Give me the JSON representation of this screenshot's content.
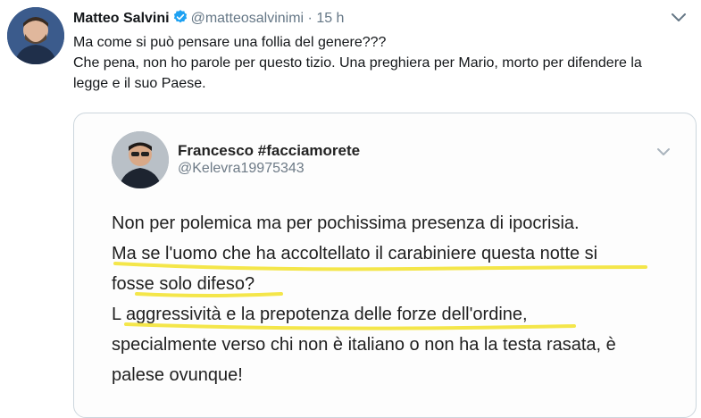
{
  "tweet": {
    "author_name": "Matteo Salvini",
    "handle": "@matteosalvinimi",
    "separator": "·",
    "time": "15 h",
    "text_line1": "Ma come si può pensare una follia del genere???",
    "text_line2": "Che pena, non ho parole per questo tizio. Una preghiera per Mario, morto per difendere la legge e il suo Paese."
  },
  "embedded_tweet": {
    "author_name": "Francesco #facciamorete",
    "handle": "@Kelevra19975343",
    "lines": [
      "Non per polemica ma per pochissima presenza di ipocrisia.",
      "Ma se l'uomo che ha accoltellato il carabiniere questa notte si",
      "fosse solo difeso?",
      "L aggressività e la prepotenza delle forze dell'ordine,",
      "specialmente verso chi non è italiano o non ha la testa rasata, è",
      "palese ovunque!"
    ]
  },
  "colors": {
    "highlight": "#f4e64a",
    "verified": "#1da1f2",
    "secondary_text": "#657786"
  },
  "icons": {
    "verified": "verified-badge-icon",
    "menu": "chevron-down-icon"
  }
}
